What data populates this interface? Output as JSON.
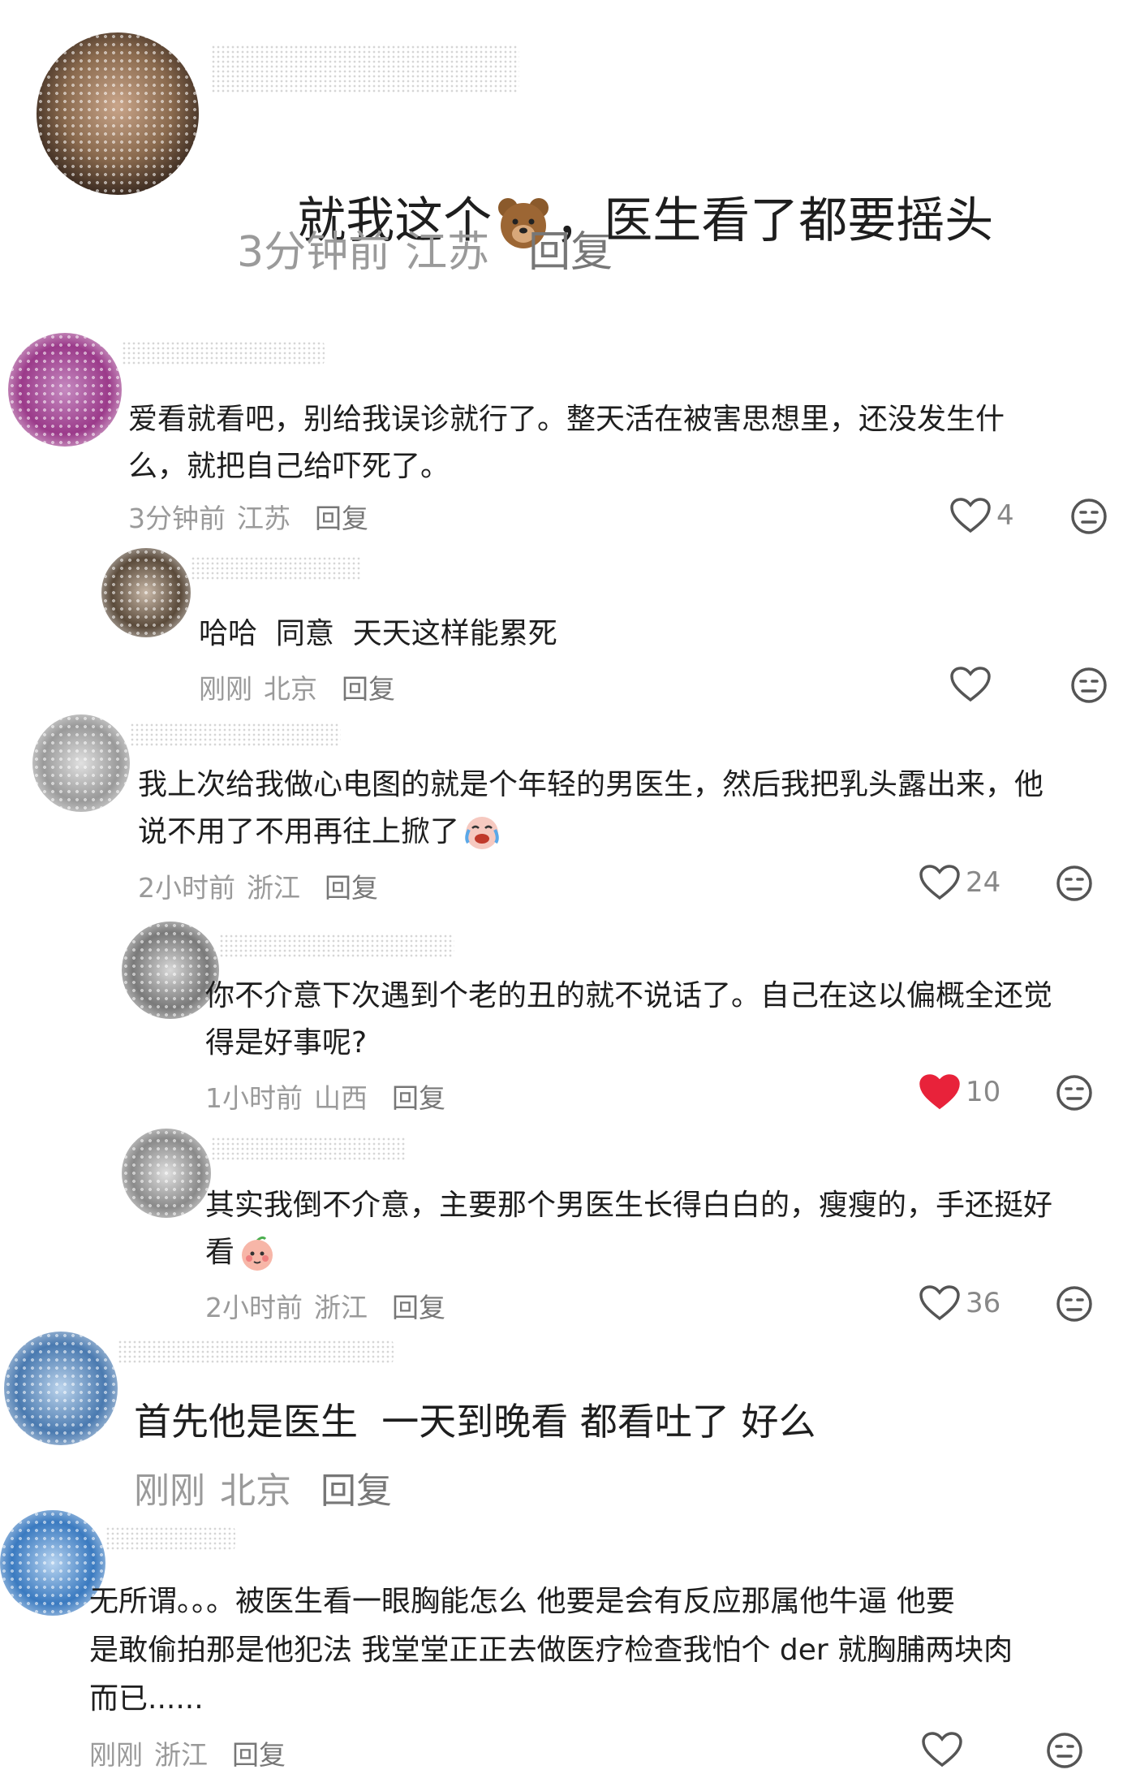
{
  "colors": {
    "text": "#1e1e1e",
    "meta": "#9a9a9a",
    "liked": "#e8223a",
    "icon": "#555555"
  },
  "comments": [
    {
      "level": "top",
      "avatar_color": "#8a6a4e",
      "text_before_emoji": "就我这个",
      "emoji": "bear-face",
      "text_after_emoji": "，医生看了都要摇头",
      "time": "3分钟前",
      "location": "江苏",
      "reply_label": "回复"
    },
    {
      "level": "reply",
      "avatar_color": "#9b3a8a",
      "text_line1": "爱看就看吧，别给我误诊就行了。整天活在被害思想里，还没发生什",
      "text_line2": "么，就把自己给吓死了。",
      "time": "3分钟前",
      "location": "江苏",
      "reply_label": "回复",
      "likes": "4",
      "liked": false
    },
    {
      "level": "reply",
      "avatar_color": "#5a4a3a",
      "text_line1": "哈哈  同意  天天这样能累死",
      "time": "刚刚",
      "location": "北京",
      "reply_label": "回复",
      "likes": "",
      "liked": false
    },
    {
      "level": "reply",
      "avatar_color": "#9a9a9a",
      "text_line1": "我上次给我做心电图的就是个年轻的男医生，然后我把乳头露出来，他",
      "text_line2": "说不用了不用再往上掀了",
      "emoji": "crying-laughing-face",
      "time": "2小时前",
      "location": "浙江",
      "reply_label": "回复",
      "likes": "24",
      "liked": false
    },
    {
      "level": "reply",
      "avatar_color": "#7a7a7a",
      "text_line1": "你不介意下次遇到个老的丑的就不说话了。自己在这以偏概全还觉",
      "text_line2": "得是好事呢?",
      "time": "1小时前",
      "location": "山西",
      "reply_label": "回复",
      "likes": "10",
      "liked": true
    },
    {
      "level": "reply",
      "avatar_color": "#8a8a8a",
      "text_line1": "其实我倒不介意，主要那个男医生长得白白的，瘦瘦的，手还挺好",
      "text_line2": "看",
      "emoji": "blushing-peach-face",
      "time": "2小时前",
      "location": "浙江",
      "reply_label": "回复",
      "likes": "36",
      "liked": false
    },
    {
      "level": "top",
      "avatar_color": "#4a7ab0",
      "text_line1": "首先他是医生  一天到晚看 都看吐了 好么",
      "time": "刚刚",
      "location": "北京",
      "reply_label": "回复"
    },
    {
      "level": "reply",
      "avatar_color": "#3a7ac0",
      "text_line1": "无所谓。。。被医生看一眼胸能怎么 他要是会有反应那属他牛逼 他要",
      "text_line2": "是敢偷拍那是他犯法 我堂堂正正去做医疗检查我怕个 der 就胸脯两块肉",
      "text_line3": "而已......",
      "time": "刚刚",
      "location": "浙江",
      "reply_label": "回复",
      "likes": "",
      "liked": false
    }
  ]
}
